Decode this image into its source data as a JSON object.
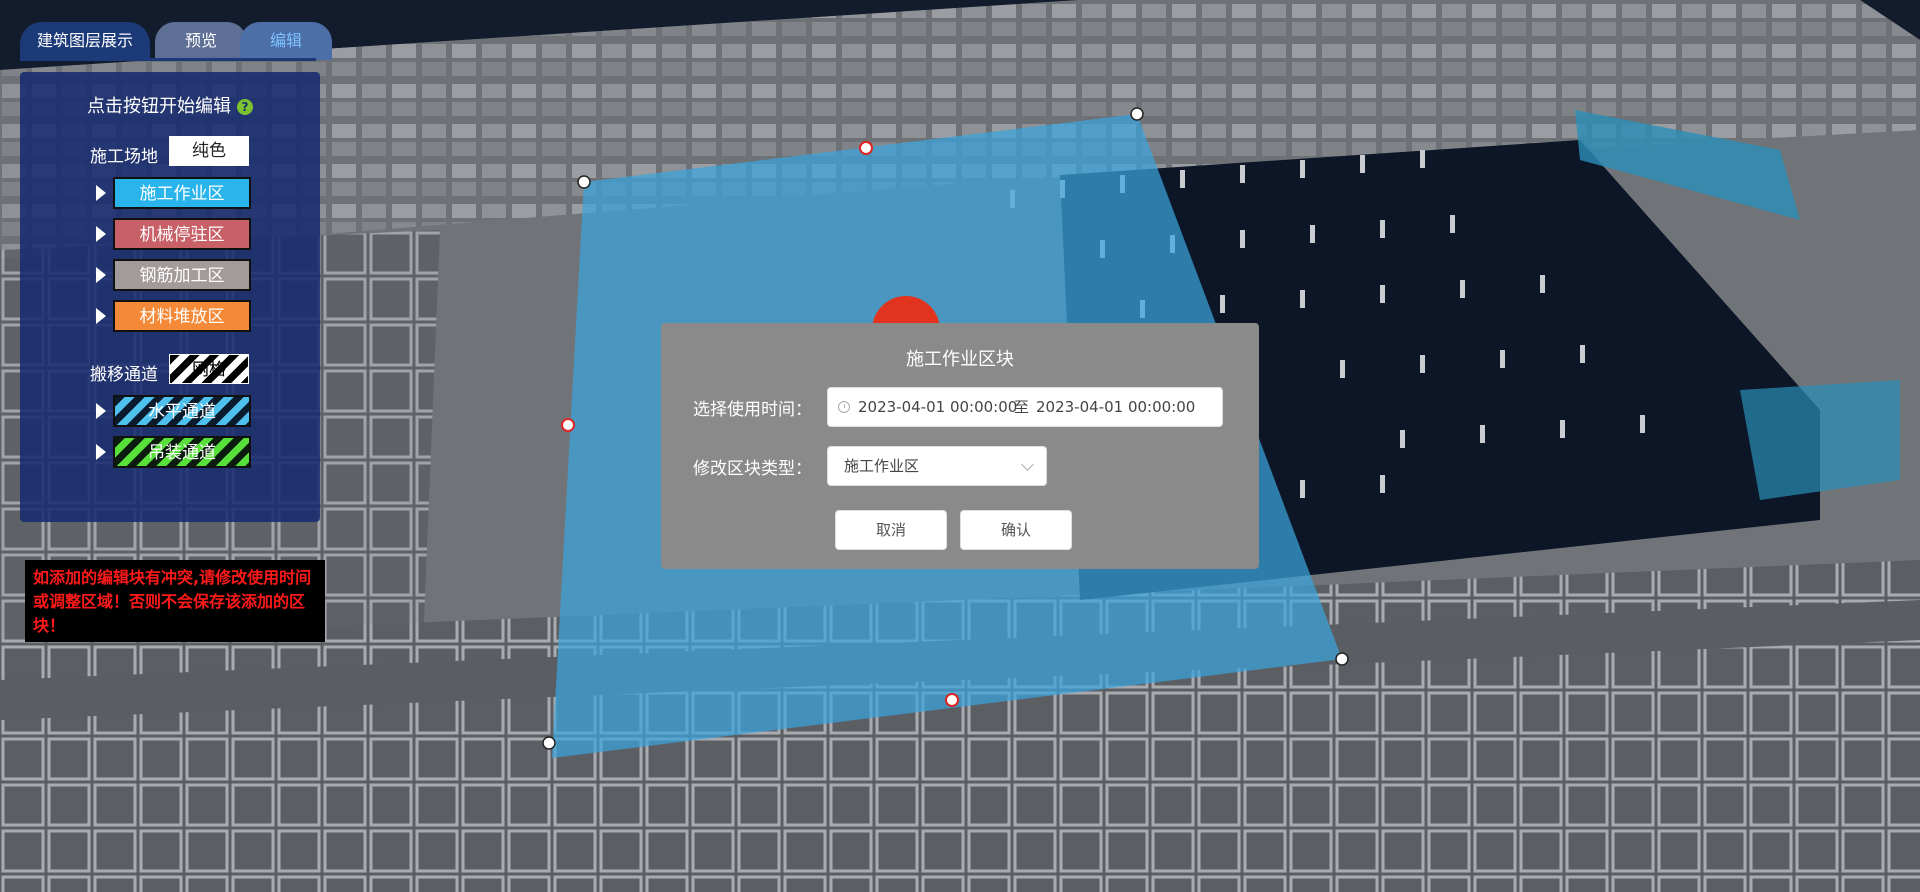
{
  "tabs": {
    "main_label": "建筑图层展示",
    "preview_label": "预览",
    "edit_label": "编辑"
  },
  "panel": {
    "title": "点击按钮开始编辑",
    "help_icon": "question-circle-icon",
    "site": {
      "label": "施工场地",
      "value": "纯色"
    },
    "zones": [
      {
        "label": "施工作业区",
        "color": "#29b5ec"
      },
      {
        "label": "机械停驻区",
        "color": "#c86068"
      },
      {
        "label": "钢筋加工区",
        "color": "#a39a9a"
      },
      {
        "label": "材料堆放区",
        "color": "#f48a38"
      }
    ],
    "passage": {
      "label": "搬移通道",
      "value": "网格"
    },
    "passages": [
      {
        "label": "水平通道",
        "color": "#4ec0ee"
      },
      {
        "label": "吊装通道",
        "color": "#58e03a"
      }
    ]
  },
  "warning": {
    "text": "如添加的编辑块有冲突,请修改使用时间或调整区域！否则不会保存该添加的区块！"
  },
  "dialog": {
    "title": "施工作业区块",
    "time_label": "选择使用时间：",
    "start_time": "2023-04-01 00:00:00",
    "range_separator": "至",
    "end_time": "2023-04-01 00:00:00",
    "type_label": "修改区块类型：",
    "type_value": "施工作业区",
    "cancel_label": "取消",
    "confirm_label": "确认"
  },
  "colors": {
    "panel_bg": "#182b6e",
    "selection_fill": "#3aa3dc",
    "warning_text": "#ff1a1a"
  }
}
